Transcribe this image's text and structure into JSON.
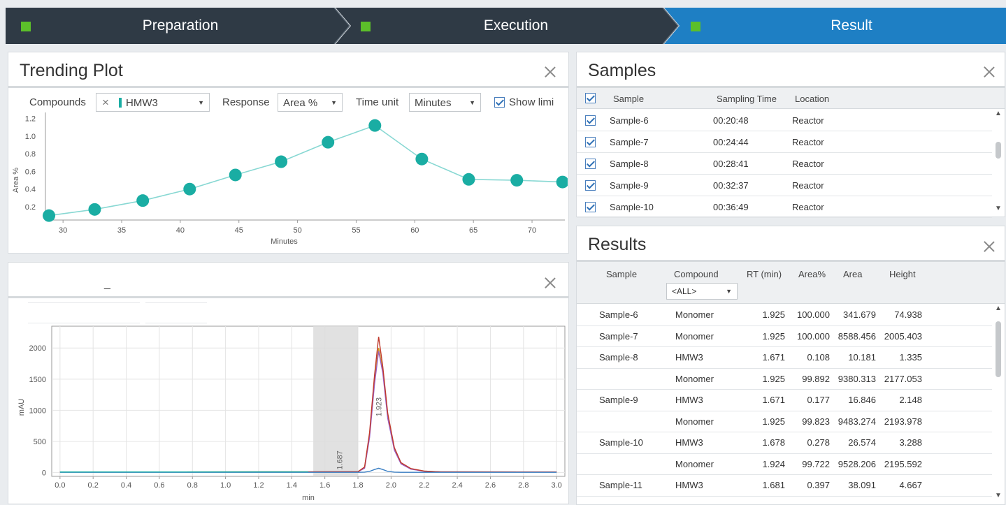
{
  "steps": [
    {
      "label": "Preparation",
      "state": "done"
    },
    {
      "label": "Execution",
      "state": "done"
    },
    {
      "label": "Result",
      "state": "active"
    }
  ],
  "colors": {
    "step_dark": "#2f3a45",
    "step_active": "#1e7fc4",
    "step_mark": "#5cbf2a",
    "series": "#1aada3",
    "series_line": "#88d8d3"
  },
  "trending": {
    "title": "Trending Plot",
    "compounds_label": "Compounds",
    "compound_value": "HMW3",
    "response_label": "Response",
    "response_value": "Area %",
    "time_unit_label": "Time unit",
    "time_unit_value": "Minutes",
    "show_limits_label": "Show limi"
  },
  "chromatogram": {
    "title": "",
    "tab_marker": "_"
  },
  "chart_data": [
    {
      "type": "line",
      "title": "",
      "xlabel": "Minutes",
      "ylabel": "Area %",
      "xlim": [
        28.5,
        72.8
      ],
      "ylim": [
        0.05,
        1.22
      ],
      "xticks": [
        30,
        35,
        40,
        45,
        50,
        55,
        60,
        65,
        70
      ],
      "yticks": [
        0.2,
        0.4,
        0.6,
        0.8,
        1.0,
        1.2
      ],
      "grid": false,
      "x": [
        28.8,
        32.7,
        36.8,
        40.8,
        44.7,
        48.6,
        52.6,
        56.6,
        60.6,
        64.6,
        68.7,
        72.6
      ],
      "y": [
        0.1,
        0.17,
        0.27,
        0.4,
        0.56,
        0.71,
        0.93,
        1.12,
        0.74,
        0.51,
        0.5,
        0.48
      ]
    },
    {
      "type": "line",
      "title": "",
      "xlabel": "min",
      "ylabel": "mAU",
      "xlim": [
        -0.05,
        3.05
      ],
      "ylim": [
        -60,
        2350
      ],
      "xticks": [
        0.0,
        0.2,
        0.4,
        0.6,
        0.8,
        1.0,
        1.2,
        1.4,
        1.6,
        1.8,
        2.0,
        2.2,
        2.4,
        2.6,
        2.8,
        3.0
      ],
      "yticks": [
        0,
        500,
        1000,
        1500,
        2000
      ],
      "grid": true,
      "highlight_range": [
        1.53,
        1.8
      ],
      "peak_labels": [
        "1.687",
        "1.923"
      ],
      "x": [
        0.0,
        1.5,
        1.8,
        1.84,
        1.87,
        1.9,
        1.925,
        1.95,
        1.98,
        2.02,
        2.06,
        2.12,
        2.2,
        2.3,
        2.8,
        3.0
      ],
      "series": [
        {
          "values": [
            10,
            12,
            15,
            80,
            600,
            1500,
            2000,
            1650,
            900,
            380,
            150,
            60,
            25,
            12,
            10,
            10
          ]
        },
        {
          "values": [
            10,
            12,
            15,
            70,
            560,
            1420,
            1950,
            1600,
            870,
            360,
            140,
            55,
            22,
            12,
            10,
            10
          ]
        },
        {
          "values": [
            10,
            12,
            15,
            90,
            640,
            1560,
            2180,
            1700,
            950,
            400,
            160,
            65,
            25,
            12,
            10,
            10
          ]
        },
        {
          "values": [
            5,
            5,
            5,
            8,
            20,
            50,
            70,
            50,
            20,
            8,
            5,
            5,
            5,
            5,
            5,
            5
          ]
        }
      ]
    }
  ],
  "samples": {
    "title": "Samples",
    "columns": [
      "Sample",
      "Sampling Time",
      "Location"
    ],
    "rows": [
      {
        "sample": "Sample-6",
        "time": "00:20:48",
        "location": "Reactor"
      },
      {
        "sample": "Sample-7",
        "time": "00:24:44",
        "location": "Reactor"
      },
      {
        "sample": "Sample-8",
        "time": "00:28:41",
        "location": "Reactor"
      },
      {
        "sample": "Sample-9",
        "time": "00:32:37",
        "location": "Reactor"
      },
      {
        "sample": "Sample-10",
        "time": "00:36:49",
        "location": "Reactor"
      }
    ]
  },
  "results": {
    "title": "Results",
    "columns": [
      "Sample",
      "Compound",
      "RT (min)",
      "Area%",
      "Area",
      "Height"
    ],
    "compound_filter": "<ALL>",
    "rows": [
      {
        "sample": "Sample-6",
        "compound": "Monomer",
        "rt": "1.925",
        "area_pct": "100.000",
        "area": "341.679",
        "height": "74.938"
      },
      {
        "sample": "Sample-7",
        "compound": "Monomer",
        "rt": "1.925",
        "area_pct": "100.000",
        "area": "8588.456",
        "height": "2005.403"
      },
      {
        "sample": "Sample-8",
        "compound": "HMW3",
        "rt": "1.671",
        "area_pct": "0.108",
        "area": "10.181",
        "height": "1.335"
      },
      {
        "sample": "",
        "compound": "Monomer",
        "rt": "1.925",
        "area_pct": "99.892",
        "area": "9380.313",
        "height": "2177.053"
      },
      {
        "sample": "Sample-9",
        "compound": "HMW3",
        "rt": "1.671",
        "area_pct": "0.177",
        "area": "16.846",
        "height": "2.148"
      },
      {
        "sample": "",
        "compound": "Monomer",
        "rt": "1.925",
        "area_pct": "99.823",
        "area": "9483.274",
        "height": "2193.978"
      },
      {
        "sample": "Sample-10",
        "compound": "HMW3",
        "rt": "1.678",
        "area_pct": "0.278",
        "area": "26.574",
        "height": "3.288"
      },
      {
        "sample": "",
        "compound": "Monomer",
        "rt": "1.924",
        "area_pct": "99.722",
        "area": "9528.206",
        "height": "2195.592"
      },
      {
        "sample": "Sample-11",
        "compound": "HMW3",
        "rt": "1.681",
        "area_pct": "0.397",
        "area": "38.091",
        "height": "4.667"
      }
    ]
  }
}
